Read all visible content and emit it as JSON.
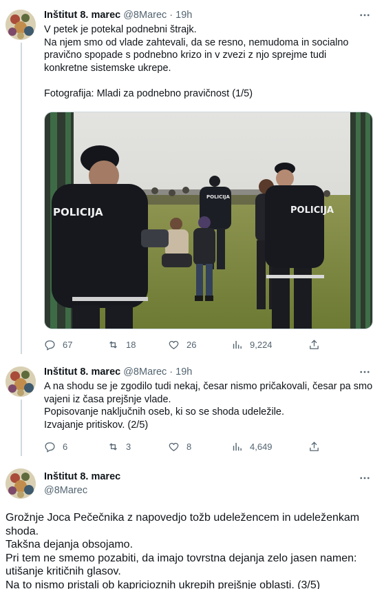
{
  "tweet1": {
    "author_name": "Inštitut 8. marec",
    "handle": "@8Marec",
    "time": "19h",
    "lines": [
      "V petek je potekal podnebni štrajk.",
      "Na njem smo od vlade zahtevali, da se resno, nemudoma in socialno",
      "pravično spopade s podnebno krizo in v zvezi z njo sprejme tudi",
      "konkretne sistemske ukrepe."
    ],
    "caption": "Fotografija: Mladi za podnebno pravičnost (1/5)",
    "photo_text": [
      "POLICIJA",
      "POLICIJA",
      "POLICIJA"
    ],
    "replies": "67",
    "retweets": "18",
    "likes": "26",
    "views": "9,224"
  },
  "tweet2": {
    "author_name": "Inštitut 8. marec",
    "handle": "@8Marec",
    "time": "19h",
    "lines": [
      "A na shodu se je zgodilo tudi nekaj, česar nismo pričakovali, česar pa smo",
      "vajeni iz časa prejšnje vlade.",
      "Popisovanje naključnih oseb, ki so se shoda udeležile.",
      "Izvajanje pritiskov. (2/5)"
    ],
    "replies": "6",
    "retweets": "3",
    "likes": "8",
    "views": "4,649"
  },
  "tweet3": {
    "author_name": "Inštitut 8. marec",
    "handle": "@8Marec",
    "lines": [
      "Grožnje Joca Pečečnika z napovedjo tožb udeležencem in udeleženkam",
      "shoda.",
      "Takšna dejanja obsojamo.",
      "Pri tem ne smemo pozabiti, da imajo tovrstna dejanja zelo jasen namen:",
      "utišanje kritičnih glasov.",
      "Na to nismo pristali ob kapricioznih ukrepih prejšnje oblasti. (3/5)"
    ]
  },
  "icons": {
    "more": "more-horizontal-icon",
    "reply": "reply-icon",
    "retweet": "retweet-icon",
    "like": "heart-icon",
    "views": "views-icon",
    "share": "share-icon"
  },
  "colors": {
    "text": "#0f1419",
    "secondary": "#536471",
    "thread_line": "#cfd9de"
  }
}
